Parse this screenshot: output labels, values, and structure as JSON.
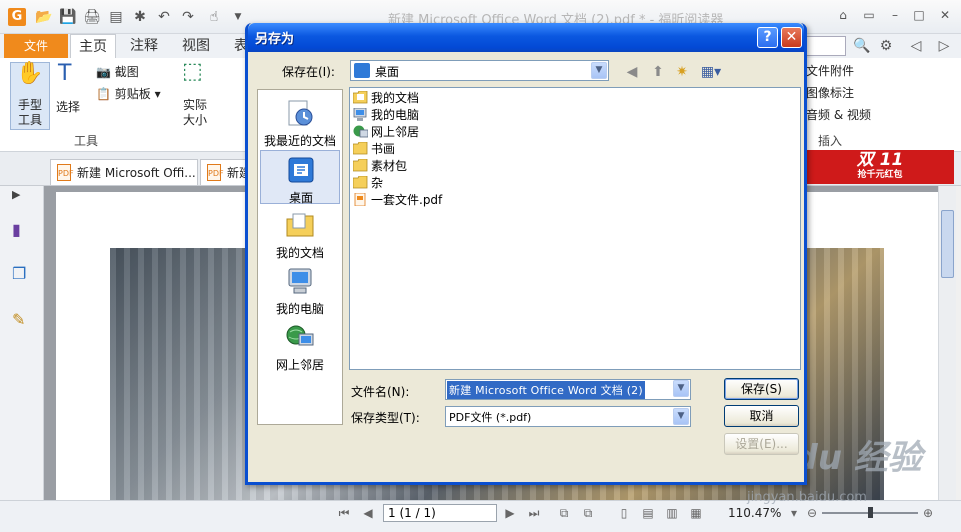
{
  "app": {
    "title": "新建 Microsoft Office Word 文档 (2).pdf * - 福昕阅读器",
    "logo_letter": "G",
    "file_tab": "文件",
    "tabs": [
      "主页",
      "注释",
      "视图",
      "表"
    ],
    "tools": {
      "hand": "手型\n工具",
      "select": "选择",
      "screenshot": "截图",
      "clipboard": "剪贴板",
      "actual_size": "实际\n大小",
      "group_tools": "工具",
      "file_attach": "文件附件",
      "image_annot": "图像标注",
      "audio_video": "音频 & 视频",
      "group_insert": "插入"
    },
    "promo": {
      "big": "双 11",
      "small": "抢千元红包"
    },
    "doc_tabs": [
      "新建 Microsoft Offi...",
      "新建"
    ],
    "page_box": "1 (1 / 1)",
    "zoom": "110.47%",
    "watermark": {
      "brand": "Baidu 经验",
      "url": "jingyan.baidu.com"
    }
  },
  "dialog": {
    "title": "另存为",
    "save_in_label": "保存在(I):",
    "save_in_value": "桌面",
    "places": [
      "我最近的文档",
      "桌面",
      "我的文档",
      "我的电脑",
      "网上邻居"
    ],
    "files": [
      "我的文档",
      "我的电脑",
      "网上邻居",
      "书画",
      "素材包",
      "杂",
      "一套文件.pdf"
    ],
    "filename_label": "文件名(N):",
    "filename_value": "新建 Microsoft Office Word 文档 (2)",
    "filetype_label": "保存类型(T):",
    "filetype_value": "PDF文件 (*.pdf)",
    "save_button": "保存(S)",
    "cancel_button": "取消",
    "settings_button": "设置(E)..."
  },
  "colors": {
    "xp_title": "#0b58e0",
    "foxit_orange": "#f08a1c",
    "selection": "#316ac5"
  }
}
